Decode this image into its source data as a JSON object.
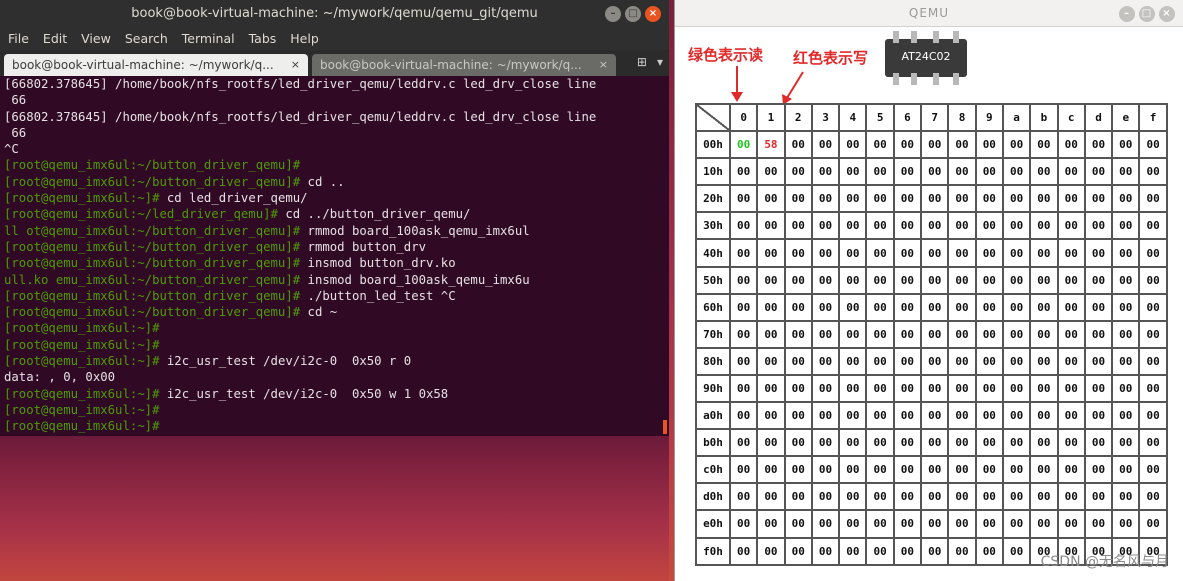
{
  "terminal": {
    "title": "book@book-virtual-machine: ~/mywork/qemu/qemu_git/qemu",
    "menu": [
      "File",
      "Edit",
      "View",
      "Search",
      "Terminal",
      "Tabs",
      "Help"
    ],
    "tabs": [
      {
        "label": "book@book-virtual-machine: ~/mywork/q...",
        "close": "×"
      },
      {
        "label": "book@book-virtual-machine: ~/mywork/q...",
        "close": "×"
      }
    ],
    "lines": [
      {
        "prompt": "",
        "text": "[66802.378645] /home/book/nfs_rootfs/led_driver_qemu/leddrv.c led_drv_close line"
      },
      {
        "prompt": "",
        "text": " 66"
      },
      {
        "prompt": "",
        "text": "[66802.378645] /home/book/nfs_rootfs/led_driver_qemu/leddrv.c led_drv_close line"
      },
      {
        "prompt": "",
        "text": " 66"
      },
      {
        "prompt": "",
        "text": "^C"
      },
      {
        "prompt": "[root@qemu_imx6ul:~/button_driver_qemu]#",
        "text": ""
      },
      {
        "prompt": "[root@qemu_imx6ul:~/button_driver_qemu]#",
        "text": " cd .."
      },
      {
        "prompt": "[root@qemu_imx6ul:~]#",
        "text": " cd led_driver_qemu/"
      },
      {
        "prompt": "[root@qemu_imx6ul:~/led_driver_qemu]#",
        "text": " cd ../button_driver_qemu/"
      },
      {
        "prompt": "ll ot@qemu_imx6ul:~/button_driver_qemu]#",
        "text": " rmmod board_100ask_qemu_imx6ul"
      },
      {
        "prompt": "[root@qemu_imx6ul:~/button_driver_qemu]#",
        "text": " rmmod button_drv"
      },
      {
        "prompt": "[root@qemu_imx6ul:~/button_driver_qemu]#",
        "text": " insmod button_drv.ko"
      },
      {
        "prompt": "ull.ko emu_imx6ul:~/button_driver_qemu]#",
        "text": " insmod board_100ask_qemu_imx6u"
      },
      {
        "prompt": "[root@qemu_imx6ul:~/button_driver_qemu]#",
        "text": " ./button_led_test ^C"
      },
      {
        "prompt": "[root@qemu_imx6ul:~/button_driver_qemu]#",
        "text": " cd ~"
      },
      {
        "prompt": "[root@qemu_imx6ul:~]#",
        "text": ""
      },
      {
        "prompt": "[root@qemu_imx6ul:~]#",
        "text": ""
      },
      {
        "prompt": "[root@qemu_imx6ul:~]#",
        "text": " i2c_usr_test /dev/i2c-0  0x50 r 0"
      },
      {
        "prompt": "",
        "text": "data: , 0, 0x00"
      },
      {
        "prompt": "[root@qemu_imx6ul:~]#",
        "text": " i2c_usr_test /dev/i2c-0  0x50 w 1 0x58"
      },
      {
        "prompt": "[root@qemu_imx6ul:~]#",
        "text": ""
      },
      {
        "prompt": "[root@qemu_imx6ul:~]#",
        "text": ""
      }
    ]
  },
  "qemu": {
    "title": "QEMU",
    "note_green": "绿色表示读",
    "note_red": "红色表示写",
    "chip_label": "AT24C02",
    "col_headers": [
      "0",
      "1",
      "2",
      "3",
      "4",
      "5",
      "6",
      "7",
      "8",
      "9",
      "a",
      "b",
      "c",
      "d",
      "e",
      "f"
    ],
    "row_headers": [
      "00h",
      "10h",
      "20h",
      "30h",
      "40h",
      "50h",
      "60h",
      "70h",
      "80h",
      "90h",
      "a0h",
      "b0h",
      "c0h",
      "d0h",
      "e0h",
      "f0h"
    ],
    "default_cell": "00",
    "highlight": [
      {
        "row": 0,
        "col": 0,
        "value": "00",
        "color": "#22c322"
      },
      {
        "row": 0,
        "col": 1,
        "value": "58",
        "color": "#e02a2a"
      }
    ]
  },
  "watermark": "CSDN @无名风与月",
  "colors": {
    "terminal_bg": "#300a24",
    "prompt": "#4e9a06",
    "accent": "#e95420"
  }
}
